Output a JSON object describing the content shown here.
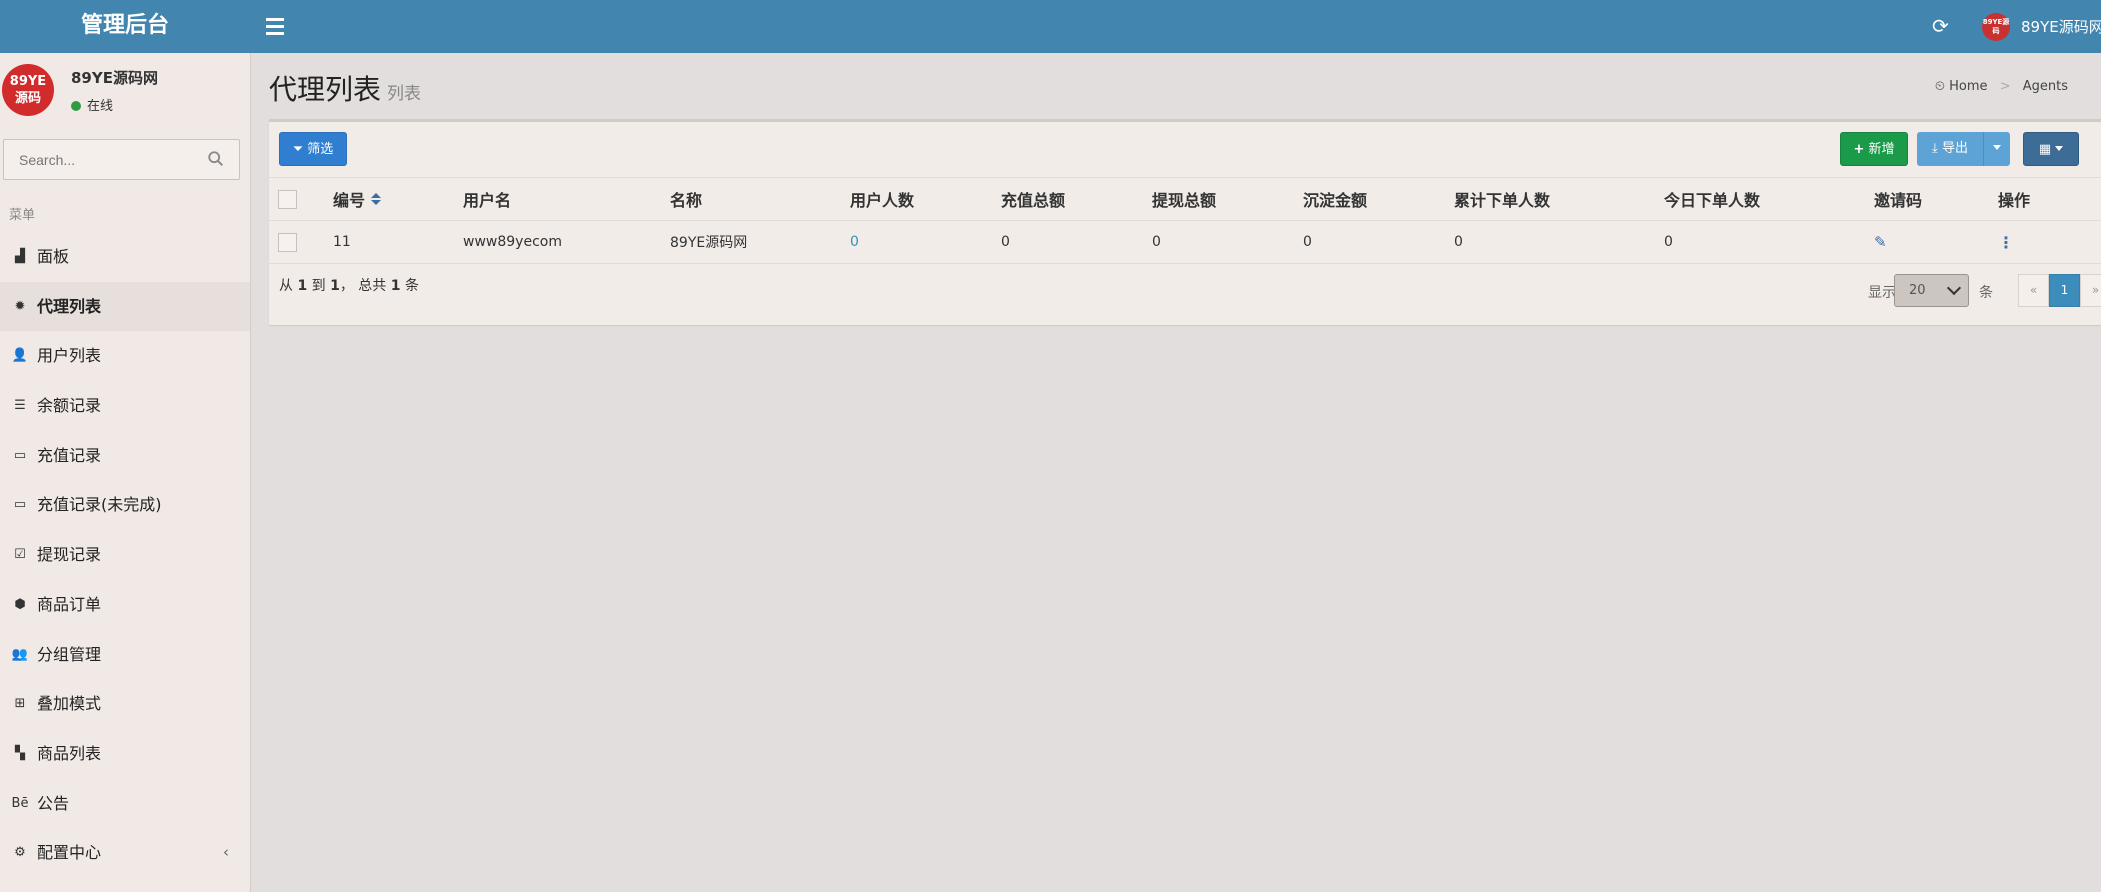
{
  "header": {
    "brand": "管理后台",
    "user_name": "89YE源码网",
    "avatar_text": "89YE源码"
  },
  "sidebar": {
    "avatar_line1": "89YE",
    "avatar_line2": "源码",
    "user_name": "89YE源码网",
    "status": "在线",
    "search_placeholder": "Search...",
    "menu_title": "菜单",
    "items": [
      {
        "label": "面板",
        "icon": "area-chart-icon",
        "glyph": "▟"
      },
      {
        "label": "代理列表",
        "icon": "gear-icon",
        "glyph": "✹"
      },
      {
        "label": "用户列表",
        "icon": "user-icon",
        "glyph": "👤"
      },
      {
        "label": "余额记录",
        "icon": "list-icon",
        "glyph": "☰"
      },
      {
        "label": "充值记录",
        "icon": "battery-full-icon",
        "glyph": "▭"
      },
      {
        "label": "充值记录(未完成)",
        "icon": "battery-empty-icon",
        "glyph": "▭"
      },
      {
        "label": "提现记录",
        "icon": "check-square-icon",
        "glyph": "☑"
      },
      {
        "label": "商品订单",
        "icon": "cube-icon",
        "glyph": "⬢"
      },
      {
        "label": "分组管理",
        "icon": "users-icon",
        "glyph": "👥"
      },
      {
        "label": "叠加模式",
        "icon": "sitemap-icon",
        "glyph": "⊞"
      },
      {
        "label": "商品列表",
        "icon": "chart-icon",
        "glyph": "▚"
      },
      {
        "label": "公告",
        "icon": "behance-icon",
        "glyph": "Bē"
      },
      {
        "label": "配置中心",
        "icon": "cogs-icon",
        "glyph": "⚙"
      }
    ]
  },
  "page": {
    "title": "代理列表",
    "subtitle": "列表",
    "breadcrumb": {
      "home": "Home",
      "current": "Agents"
    }
  },
  "toolbar": {
    "filter_label": "筛选",
    "add_label": "新增",
    "export_label": "导出"
  },
  "table": {
    "columns": [
      "编号",
      "用户名",
      "名称",
      "用户人数",
      "充值总额",
      "提现总额",
      "沉淀金额",
      "累计下单人数",
      "今日下单人数",
      "邀请码",
      "操作"
    ],
    "rows": [
      {
        "id": "11",
        "username": "www89yecom",
        "name": "89YE源码网",
        "user_count": "0",
        "recharge_total": "0",
        "withdraw_total": "0",
        "deposit_amount": "0",
        "total_buyers": "0",
        "today_buyers": "0"
      }
    ]
  },
  "footer": {
    "summary_from": "从",
    "summary_start": "1",
    "summary_to": "到",
    "summary_end": "1",
    "summary_total_prefix": "， 总共",
    "summary_total": "1",
    "summary_total_suffix": "条",
    "show_label": "显示",
    "page_size": "20",
    "unit_label": "条",
    "prev": "«",
    "current_page": "1",
    "next": "»"
  },
  "colors": {
    "topbar": "#4285af",
    "primary": "#2f7ecf",
    "success": "#1b9b4a",
    "info": "#5da3d6",
    "dark": "#3d6c96",
    "online": "#2f9b42"
  }
}
